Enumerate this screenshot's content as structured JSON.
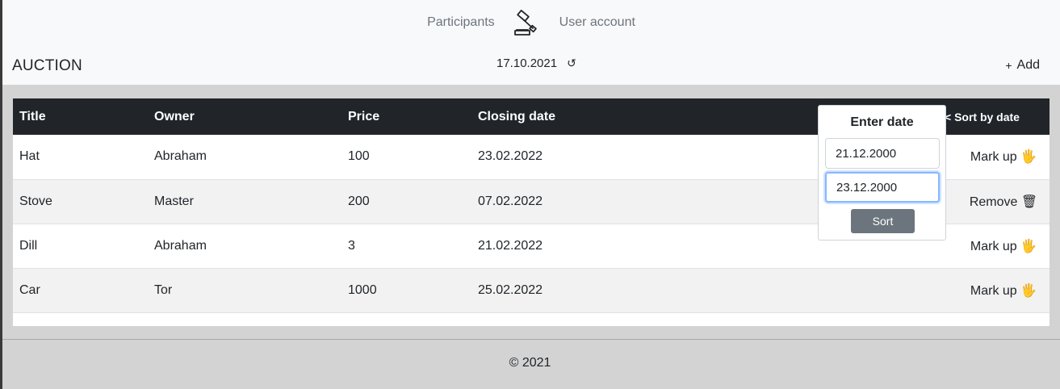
{
  "nav": {
    "participants": "Participants",
    "user_account": "User account"
  },
  "header": {
    "brand": "AUCTION",
    "date": "17.10.2021",
    "refresh_icon": "↺",
    "add_label": "Add",
    "add_icon": "+"
  },
  "table": {
    "headers": [
      "Title",
      "Owner",
      "Price",
      "Closing date"
    ],
    "sort_label": "< Sort by date",
    "rows": [
      {
        "title": "Hat",
        "owner": "Abraham",
        "price": "100",
        "date": "23.02.2022",
        "action": "Mark up 🖐"
      },
      {
        "title": "Stove",
        "owner": "Master",
        "price": "200",
        "date": "07.02.2022",
        "action": "Remove 🗑"
      },
      {
        "title": "Dill",
        "owner": "Abraham",
        "price": "3",
        "date": "21.02.2022",
        "action": "Mark up 🖐"
      },
      {
        "title": "Car",
        "owner": "Tor",
        "price": "1000",
        "date": "25.02.2022",
        "action": "Mark up 🖐"
      }
    ]
  },
  "popup": {
    "title": "Enter date",
    "from_value": "21.12.2000",
    "to_value": "23.12.2000",
    "sort_button": "Sort"
  },
  "footer": {
    "text": "© 2021"
  },
  "colors": {
    "header_bg": "#f8f9fa",
    "table_head": "#212529",
    "page_bg": "#d3d3d3",
    "button": "#6c757d",
    "focus": "#86b7fe"
  }
}
